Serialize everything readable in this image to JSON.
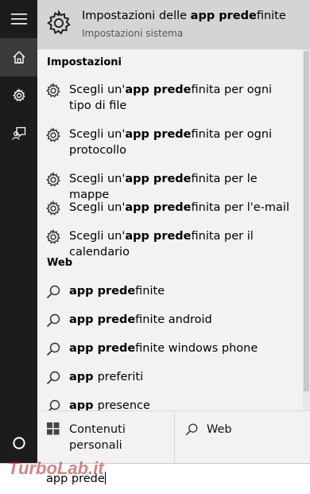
{
  "best_match": {
    "title_prefix": "Impostazioni delle ",
    "title_bold": "app prede",
    "title_suffix": "finite",
    "subtitle": "Impostazioni sistema",
    "icon": "gear-icon"
  },
  "sections": {
    "settings": "Impostazioni",
    "web": "Web"
  },
  "settings_items": [
    {
      "pre": "Scegli un'",
      "bold": "app prede",
      "post": "finita per ogni tipo di file"
    },
    {
      "pre": "Scegli un'",
      "bold": "app prede",
      "post": "finita per ogni protocollo"
    },
    {
      "pre": "Scegli un'",
      "bold": "app prede",
      "post": "finita per le mappe"
    },
    {
      "pre": "Scegli un'",
      "bold": "app prede",
      "post": "finita per l'e-mail"
    },
    {
      "pre": "Scegli un'",
      "bold": "app prede",
      "post": "finita per il calendario"
    }
  ],
  "web_items": [
    {
      "bold": "app prede",
      "post": "finite"
    },
    {
      "bold": "app prede",
      "post": "finite android"
    },
    {
      "bold": "app prede",
      "post": "finite windows phone"
    },
    {
      "bold": "app ",
      "post": "preferiti"
    },
    {
      "bold": "app ",
      "post": "presence"
    }
  ],
  "filters": {
    "personal": "Contenuti personali",
    "web": "Web"
  },
  "search": {
    "query": "app prede"
  },
  "watermark": "TurboLab.it",
  "rail_icons": [
    "hamburger-icon",
    "home-icon",
    "gear-icon",
    "feedback-icon",
    "cortana-icon",
    "windows-icon"
  ],
  "colors": {
    "rail": "#1c1c1c",
    "panel": "#f2f2f2",
    "highlight": "#d4d4d4"
  }
}
